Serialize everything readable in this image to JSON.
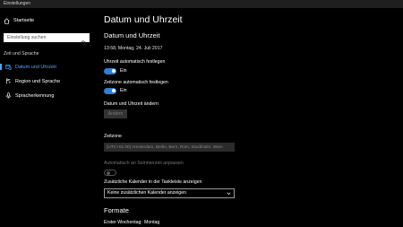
{
  "window": {
    "title": "Einstellungen"
  },
  "sidebar": {
    "home_label": "Startseite",
    "search_placeholder": "Einstellung suchen",
    "section_label": "Zeit und Sprache",
    "items": [
      {
        "label": "Datum und Uhrzeit",
        "icon": "calendar-clock-icon",
        "selected": true
      },
      {
        "label": "Region und Sprache",
        "icon": "region-language-icon",
        "selected": false
      },
      {
        "label": "Spracherkennung",
        "icon": "microphone-icon",
        "selected": false
      }
    ]
  },
  "main": {
    "page_title": "Datum und Uhrzeit",
    "subheader": "Datum und Uhrzeit",
    "current_datetime": "13:58, Montag, 24. Juli 2017",
    "auto_time": {
      "label": "Uhrzeit automatisch festlegen",
      "state": "Ein",
      "on": true
    },
    "auto_timezone": {
      "label": "Zeitzone automatisch festlegen",
      "state": "Ein",
      "on": true
    },
    "change_datetime": {
      "label": "Datum und Uhrzeit ändern",
      "button": "Ändern"
    },
    "timezone": {
      "label": "Zeitzone",
      "value": "(UTC+01:00) Amsterdam, Berlin, Bern, Rom, Stockholm, Wien"
    },
    "daylight_saving": {
      "label": "Automatisch an Sommerzeit anpassen",
      "on": false
    },
    "additional_calendars": {
      "label": "Zusätzliche Kalender in der Taskleiste anzeigen",
      "value": "Keine zusätzlichen Kalender anzeigen"
    },
    "formats": {
      "header": "Formate",
      "first_weekday_label": "Erster Wochentag:",
      "first_weekday_value": "Montag"
    }
  },
  "colors": {
    "accent": "#4ea6ff",
    "toggle_on": "#2d7fd4",
    "background": "#000000"
  }
}
